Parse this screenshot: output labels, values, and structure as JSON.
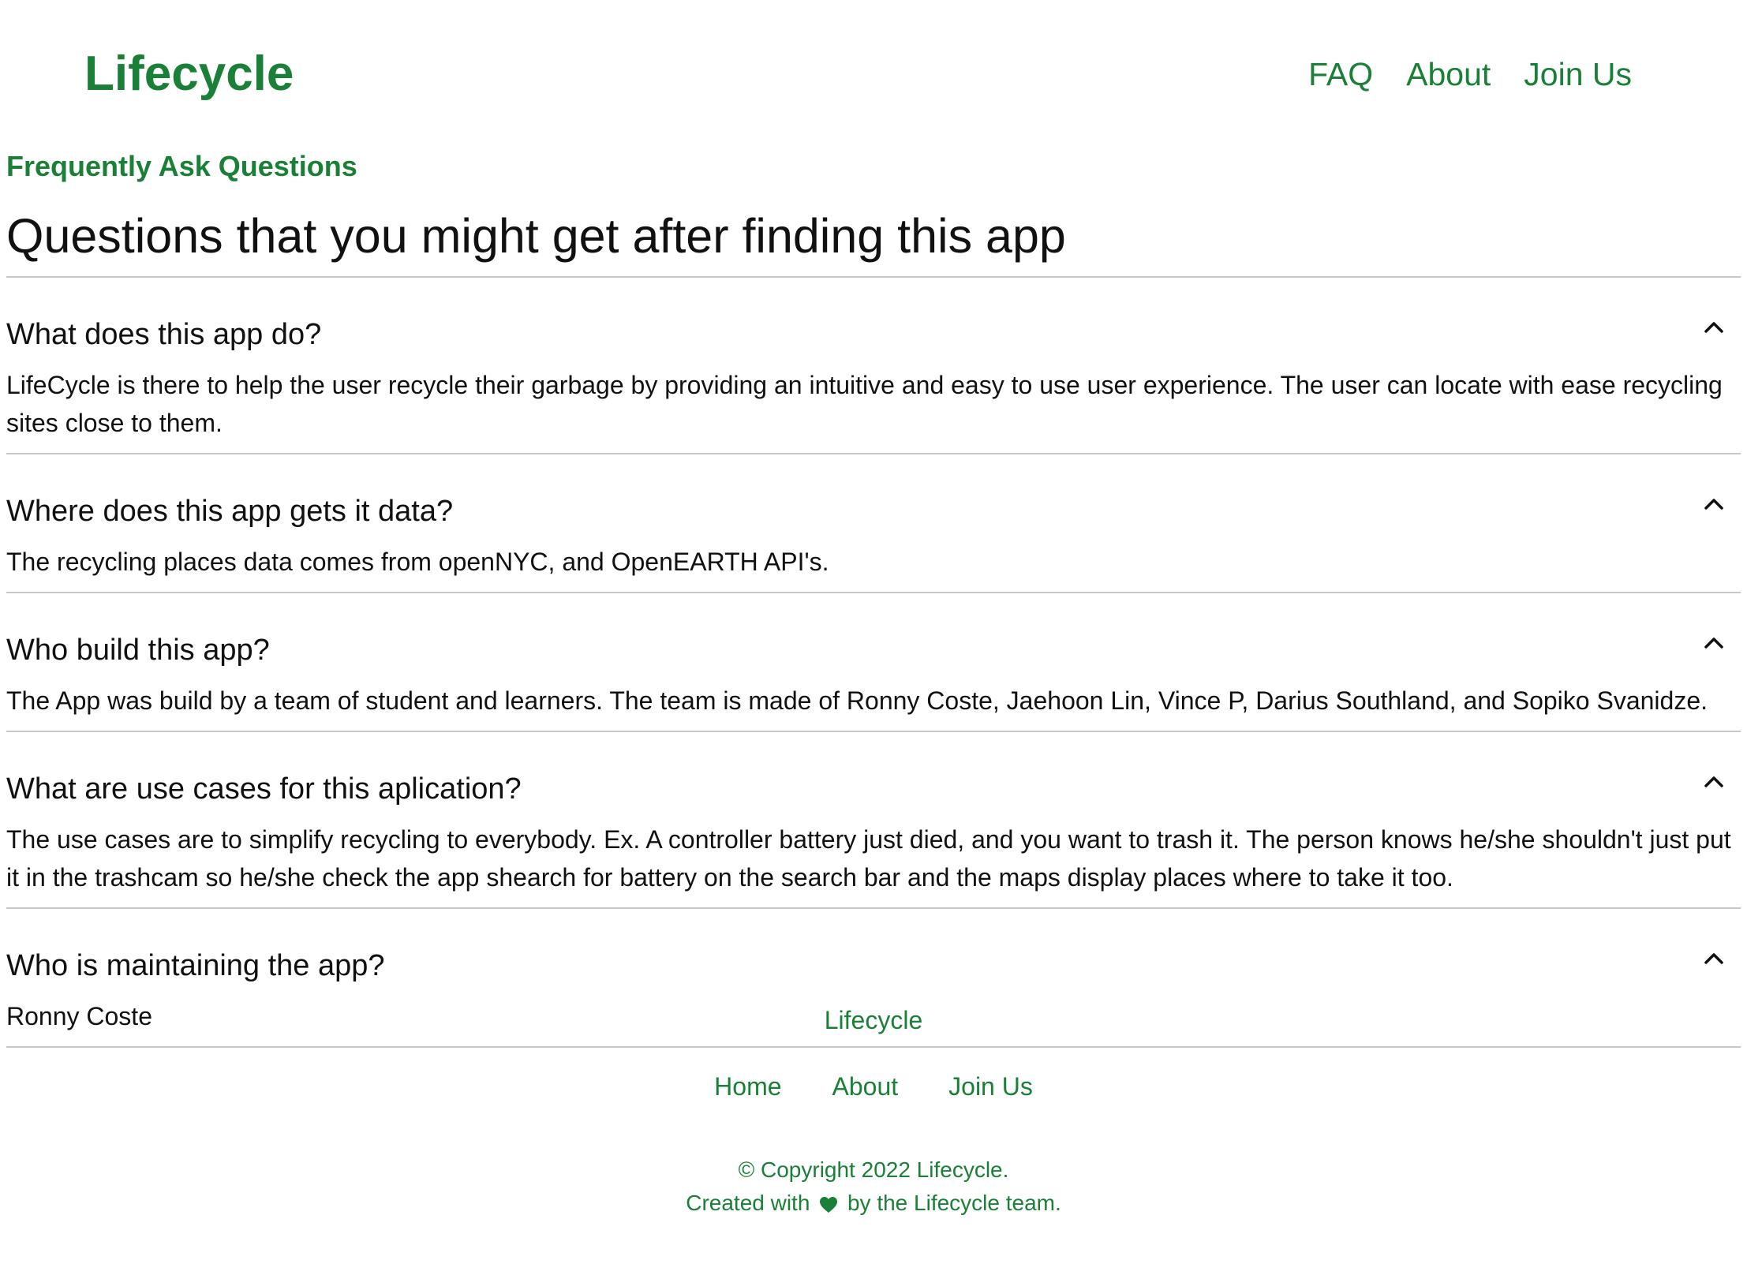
{
  "header": {
    "brand": "Lifecycle",
    "nav": [
      "FAQ",
      "About",
      "Join Us"
    ]
  },
  "main": {
    "eyebrow": "Frequently Ask Questions",
    "title": "Questions that you might get after finding this app",
    "faqs": [
      {
        "question": "What does this app do?",
        "answer": "LifeCycle is there to help the user recycle their garbage by providing an intuitive and easy to use user experience. The user can locate with ease recycling sites close to them.",
        "icon": "chevron-up-icon"
      },
      {
        "question": "Where does this app gets it data?",
        "answer": "The recycling places data comes from openNYC, and OpenEARTH API's.",
        "icon": "chevron-up-icon"
      },
      {
        "question": "Who build this app?",
        "answer": "The App was build by a team of student and learners. The team is made of Ronny Coste, Jaehoon Lin, Vince P, Darius Southland, and Sopiko Svanidze.",
        "icon": "chevron-up-icon"
      },
      {
        "question": "What are use cases for this aplication?",
        "answer": "The use cases are to simplify recycling to everybody. Ex. A controller battery just died, and you want to trash it. The person knows he/she shouldn't just put it in the trashcam so he/she check the app shearch for battery on the search bar and the maps display places where to take it too.",
        "icon": "chevron-up-icon"
      },
      {
        "question": "Who is maintaining the app?",
        "answer": "Ronny Coste",
        "icon": "chevron-up-icon"
      }
    ]
  },
  "footer": {
    "brand": "Lifecycle",
    "nav": [
      "Home",
      "About",
      "Join Us"
    ],
    "copyright": "© Copyright 2022 Lifecycle.",
    "created_prefix": "Created with",
    "created_suffix": "by the Lifecycle team.",
    "heart_icon": "heart-icon"
  },
  "colors": {
    "accent": "#1a7f37",
    "text": "#111111",
    "divider": "#c8c8c8"
  }
}
